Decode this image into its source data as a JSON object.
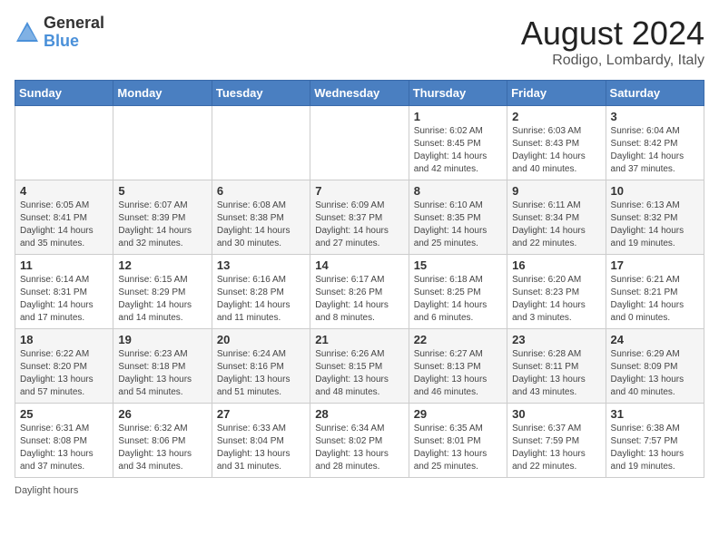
{
  "header": {
    "logo_general": "General",
    "logo_blue": "Blue",
    "month_year": "August 2024",
    "location": "Rodigo, Lombardy, Italy"
  },
  "days_of_week": [
    "Sunday",
    "Monday",
    "Tuesday",
    "Wednesday",
    "Thursday",
    "Friday",
    "Saturday"
  ],
  "footer": {
    "daylight_label": "Daylight hours"
  },
  "weeks": [
    [
      {
        "day": "",
        "info": ""
      },
      {
        "day": "",
        "info": ""
      },
      {
        "day": "",
        "info": ""
      },
      {
        "day": "",
        "info": ""
      },
      {
        "day": "1",
        "info": "Sunrise: 6:02 AM\nSunset: 8:45 PM\nDaylight: 14 hours\nand 42 minutes."
      },
      {
        "day": "2",
        "info": "Sunrise: 6:03 AM\nSunset: 8:43 PM\nDaylight: 14 hours\nand 40 minutes."
      },
      {
        "day": "3",
        "info": "Sunrise: 6:04 AM\nSunset: 8:42 PM\nDaylight: 14 hours\nand 37 minutes."
      }
    ],
    [
      {
        "day": "4",
        "info": "Sunrise: 6:05 AM\nSunset: 8:41 PM\nDaylight: 14 hours\nand 35 minutes."
      },
      {
        "day": "5",
        "info": "Sunrise: 6:07 AM\nSunset: 8:39 PM\nDaylight: 14 hours\nand 32 minutes."
      },
      {
        "day": "6",
        "info": "Sunrise: 6:08 AM\nSunset: 8:38 PM\nDaylight: 14 hours\nand 30 minutes."
      },
      {
        "day": "7",
        "info": "Sunrise: 6:09 AM\nSunset: 8:37 PM\nDaylight: 14 hours\nand 27 minutes."
      },
      {
        "day": "8",
        "info": "Sunrise: 6:10 AM\nSunset: 8:35 PM\nDaylight: 14 hours\nand 25 minutes."
      },
      {
        "day": "9",
        "info": "Sunrise: 6:11 AM\nSunset: 8:34 PM\nDaylight: 14 hours\nand 22 minutes."
      },
      {
        "day": "10",
        "info": "Sunrise: 6:13 AM\nSunset: 8:32 PM\nDaylight: 14 hours\nand 19 minutes."
      }
    ],
    [
      {
        "day": "11",
        "info": "Sunrise: 6:14 AM\nSunset: 8:31 PM\nDaylight: 14 hours\nand 17 minutes."
      },
      {
        "day": "12",
        "info": "Sunrise: 6:15 AM\nSunset: 8:29 PM\nDaylight: 14 hours\nand 14 minutes."
      },
      {
        "day": "13",
        "info": "Sunrise: 6:16 AM\nSunset: 8:28 PM\nDaylight: 14 hours\nand 11 minutes."
      },
      {
        "day": "14",
        "info": "Sunrise: 6:17 AM\nSunset: 8:26 PM\nDaylight: 14 hours\nand 8 minutes."
      },
      {
        "day": "15",
        "info": "Sunrise: 6:18 AM\nSunset: 8:25 PM\nDaylight: 14 hours\nand 6 minutes."
      },
      {
        "day": "16",
        "info": "Sunrise: 6:20 AM\nSunset: 8:23 PM\nDaylight: 14 hours\nand 3 minutes."
      },
      {
        "day": "17",
        "info": "Sunrise: 6:21 AM\nSunset: 8:21 PM\nDaylight: 14 hours\nand 0 minutes."
      }
    ],
    [
      {
        "day": "18",
        "info": "Sunrise: 6:22 AM\nSunset: 8:20 PM\nDaylight: 13 hours\nand 57 minutes."
      },
      {
        "day": "19",
        "info": "Sunrise: 6:23 AM\nSunset: 8:18 PM\nDaylight: 13 hours\nand 54 minutes."
      },
      {
        "day": "20",
        "info": "Sunrise: 6:24 AM\nSunset: 8:16 PM\nDaylight: 13 hours\nand 51 minutes."
      },
      {
        "day": "21",
        "info": "Sunrise: 6:26 AM\nSunset: 8:15 PM\nDaylight: 13 hours\nand 48 minutes."
      },
      {
        "day": "22",
        "info": "Sunrise: 6:27 AM\nSunset: 8:13 PM\nDaylight: 13 hours\nand 46 minutes."
      },
      {
        "day": "23",
        "info": "Sunrise: 6:28 AM\nSunset: 8:11 PM\nDaylight: 13 hours\nand 43 minutes."
      },
      {
        "day": "24",
        "info": "Sunrise: 6:29 AM\nSunset: 8:09 PM\nDaylight: 13 hours\nand 40 minutes."
      }
    ],
    [
      {
        "day": "25",
        "info": "Sunrise: 6:31 AM\nSunset: 8:08 PM\nDaylight: 13 hours\nand 37 minutes."
      },
      {
        "day": "26",
        "info": "Sunrise: 6:32 AM\nSunset: 8:06 PM\nDaylight: 13 hours\nand 34 minutes."
      },
      {
        "day": "27",
        "info": "Sunrise: 6:33 AM\nSunset: 8:04 PM\nDaylight: 13 hours\nand 31 minutes."
      },
      {
        "day": "28",
        "info": "Sunrise: 6:34 AM\nSunset: 8:02 PM\nDaylight: 13 hours\nand 28 minutes."
      },
      {
        "day": "29",
        "info": "Sunrise: 6:35 AM\nSunset: 8:01 PM\nDaylight: 13 hours\nand 25 minutes."
      },
      {
        "day": "30",
        "info": "Sunrise: 6:37 AM\nSunset: 7:59 PM\nDaylight: 13 hours\nand 22 minutes."
      },
      {
        "day": "31",
        "info": "Sunrise: 6:38 AM\nSunset: 7:57 PM\nDaylight: 13 hours\nand 19 minutes."
      }
    ]
  ]
}
